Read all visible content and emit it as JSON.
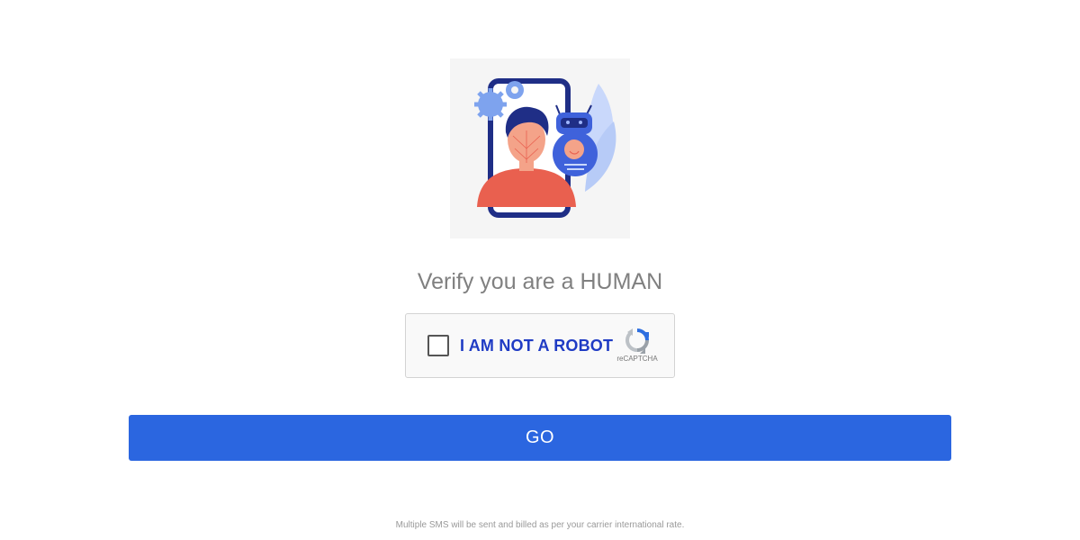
{
  "heading": "Verify you are a HUMAN",
  "captcha": {
    "label": "I AM NOT A ROBOT",
    "brand": "reCAPTCHA",
    "checked": false
  },
  "go_button": {
    "label": "GO"
  },
  "footnote": "Multiple SMS will be sent and billed as per your carrier international rate.",
  "colors": {
    "accent": "#2b66e0",
    "captcha_label": "#1f3bc4",
    "heading": "#808080"
  }
}
